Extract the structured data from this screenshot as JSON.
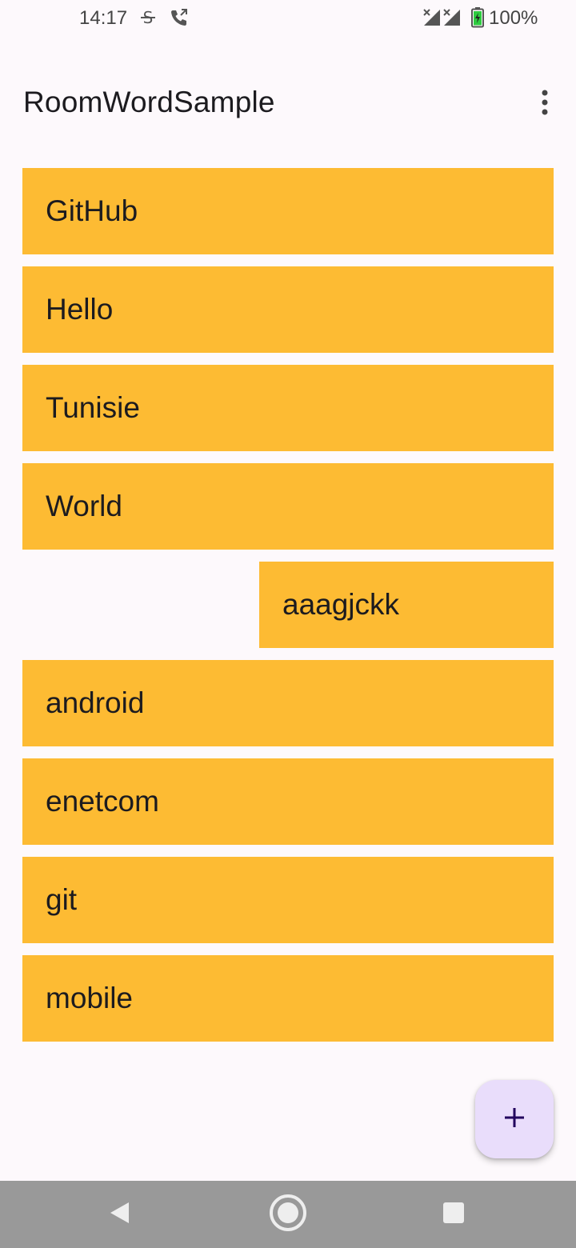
{
  "status_bar": {
    "time": "14:17",
    "battery": "100%",
    "icons": [
      "sim-icon",
      "call-icon",
      "signal-icon",
      "signal-icon",
      "battery-icon"
    ]
  },
  "app_bar": {
    "title": "RoomWordSample",
    "menu_icon": "more-vert-icon"
  },
  "words": [
    "GitHub",
    "Hello",
    "Tunisie",
    "World",
    "aaagjckk",
    "android",
    "enetcom",
    "git",
    "mobile"
  ],
  "fab": {
    "icon": "add-icon"
  },
  "nav_bar": {
    "buttons": [
      "back-icon",
      "home-icon",
      "recents-icon"
    ]
  },
  "colors": {
    "item_background": "#fdbb33",
    "page_background": "#fdf9fc",
    "fab_background": "#e9ddfb",
    "fab_icon": "#21005d",
    "nav_background": "#999999"
  }
}
